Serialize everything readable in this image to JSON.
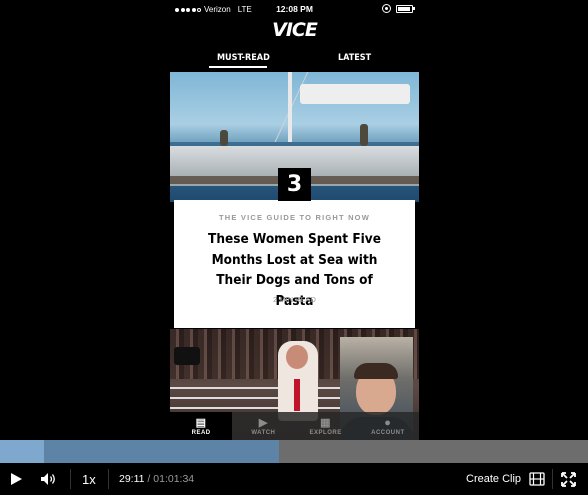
{
  "status_bar": {
    "carrier": "Verizon",
    "network": "LTE",
    "time": "12:08 PM"
  },
  "app": {
    "logo": "VICE"
  },
  "tabs": [
    {
      "label": "MUST-READ",
      "active": true
    },
    {
      "label": "LATEST",
      "active": false
    }
  ],
  "article": {
    "rank": "3",
    "kicker": "THE VICE GUIDE TO RIGHT NOW",
    "headline": "These Women Spent Five Months Lost at Sea with Their Dogs and Tons of Pasta",
    "read_time": "2 MIN READ"
  },
  "bottom_nav": [
    {
      "label": "READ",
      "icon": "newspaper-icon",
      "active": true
    },
    {
      "label": "WATCH",
      "icon": "play-icon",
      "active": false
    },
    {
      "label": "EXPLORE",
      "icon": "grid-icon",
      "active": false
    },
    {
      "label": "ACCOUNT",
      "icon": "user-icon",
      "active": false
    }
  ],
  "player": {
    "speed": "1x",
    "current_time": "29:11",
    "separator": " / ",
    "duration": "01:01:34",
    "clip_label": "Create Clip",
    "progress_fraction": 0.474,
    "buffered_fraction": 0.474
  },
  "colors": {
    "progress_played": "#5d84a7",
    "progress_track": "#6d6d6d",
    "background": "#000000"
  }
}
